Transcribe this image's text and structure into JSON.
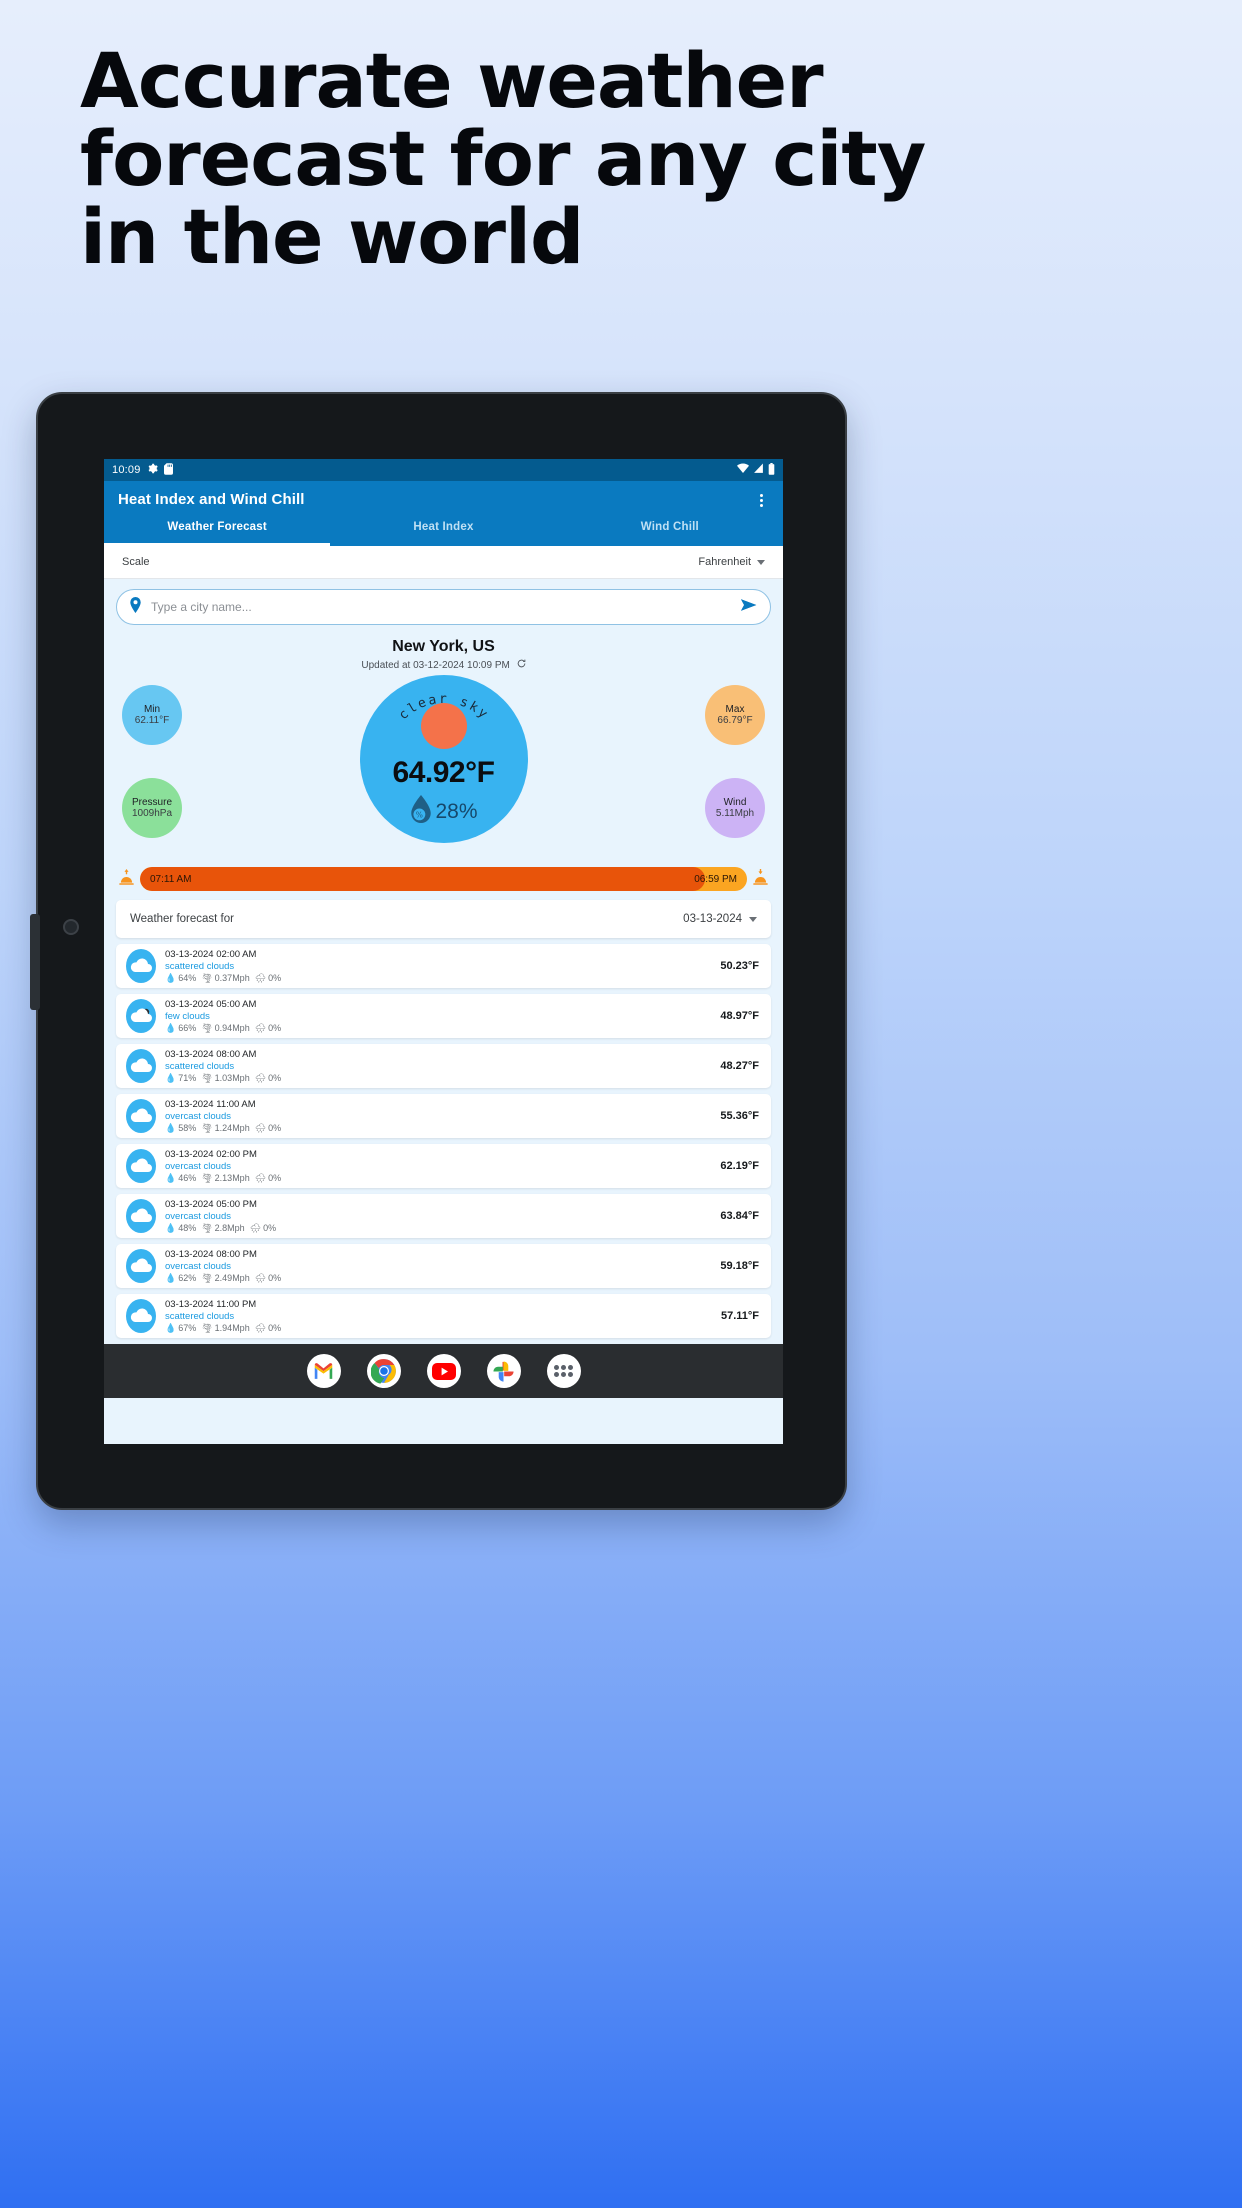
{
  "headline": {
    "lines": [
      "Accurate weather",
      "forecast for any city",
      "in the world"
    ]
  },
  "device": {
    "statusbar": {
      "time": "10:09",
      "left_icons": [
        "gear-icon",
        "sd-card-icon"
      ],
      "right_icons": [
        "wifi-icon",
        "cellular-signal-icon",
        "battery-icon"
      ]
    },
    "dock": {
      "icons": [
        "gmail-icon",
        "chrome-icon",
        "youtube-icon",
        "google-photos-icon",
        "app-drawer-icon"
      ]
    }
  },
  "app": {
    "title": "Heat Index and Wind Chill",
    "overflow_menu": "more-options",
    "tabs": [
      {
        "label": "Weather Forecast",
        "active": true
      },
      {
        "label": "Heat Index",
        "active": false
      },
      {
        "label": "Wind Chill",
        "active": false
      }
    ],
    "scale": {
      "label": "Scale",
      "value": "Fahrenheit"
    },
    "search": {
      "placeholder": "Type a city name...",
      "value": ""
    },
    "current": {
      "city": "New York, US",
      "updated": "Updated at 03-12-2024 10:09 PM",
      "condition": "clear sky",
      "temperature": "64.92°F",
      "humidity": "28%",
      "min_label": "Min",
      "min_value": "62.11°F",
      "max_label": "Max",
      "max_value": "66.79°F",
      "pressure_label": "Pressure",
      "pressure_value": "1009hPa",
      "wind_label": "Wind",
      "wind_value": "5.11Mph",
      "sunrise": "07:11 AM",
      "sunset": "06:59 PM",
      "daylight_progress": 93
    },
    "forecast": {
      "header_label": "Weather forecast for",
      "selected_date": "03-13-2024",
      "rows": [
        {
          "time": "03-13-2024 02:00 AM",
          "condition": "scattered clouds",
          "humidity": "64%",
          "wind": "0.37Mph",
          "rain": "0%",
          "temp": "50.23°F",
          "icon": "cloud-icon"
        },
        {
          "time": "03-13-2024 05:00 AM",
          "condition": "few clouds",
          "humidity": "66%",
          "wind": "0.94Mph",
          "rain": "0%",
          "temp": "48.97°F",
          "icon": "few-clouds-icon"
        },
        {
          "time": "03-13-2024 08:00 AM",
          "condition": "scattered clouds",
          "humidity": "71%",
          "wind": "1.03Mph",
          "rain": "0%",
          "temp": "48.27°F",
          "icon": "cloud-icon"
        },
        {
          "time": "03-13-2024 11:00 AM",
          "condition": "overcast clouds",
          "humidity": "58%",
          "wind": "1.24Mph",
          "rain": "0%",
          "temp": "55.36°F",
          "icon": "overcast-icon"
        },
        {
          "time": "03-13-2024 02:00 PM",
          "condition": "overcast clouds",
          "humidity": "46%",
          "wind": "2.13Mph",
          "rain": "0%",
          "temp": "62.19°F",
          "icon": "overcast-icon"
        },
        {
          "time": "03-13-2024 05:00 PM",
          "condition": "overcast clouds",
          "humidity": "48%",
          "wind": "2.8Mph",
          "rain": "0%",
          "temp": "63.84°F",
          "icon": "overcast-icon"
        },
        {
          "time": "03-13-2024 08:00 PM",
          "condition": "overcast clouds",
          "humidity": "62%",
          "wind": "2.49Mph",
          "rain": "0%",
          "temp": "59.18°F",
          "icon": "overcast-icon"
        },
        {
          "time": "03-13-2024 11:00 PM",
          "condition": "scattered clouds",
          "humidity": "67%",
          "wind": "1.94Mph",
          "rain": "0%",
          "temp": "57.11°F",
          "icon": "cloud-icon"
        }
      ]
    }
  },
  "colors": {
    "appbar": "#0a7ac0",
    "statusbar": "#045b8f",
    "content_bg": "#e8f4fd",
    "main_circle": "#38b3f0",
    "sun": "#f4724a",
    "min_bubble": "#67c7f2",
    "max_bubble": "#f9bf76",
    "pressure_bubble": "#8be09a",
    "wind_bubble": "#ccb3f5",
    "sunbar_fill": "#e8540a",
    "sunbar_track": "#fba521",
    "condition_text": "#1a9ae0"
  }
}
